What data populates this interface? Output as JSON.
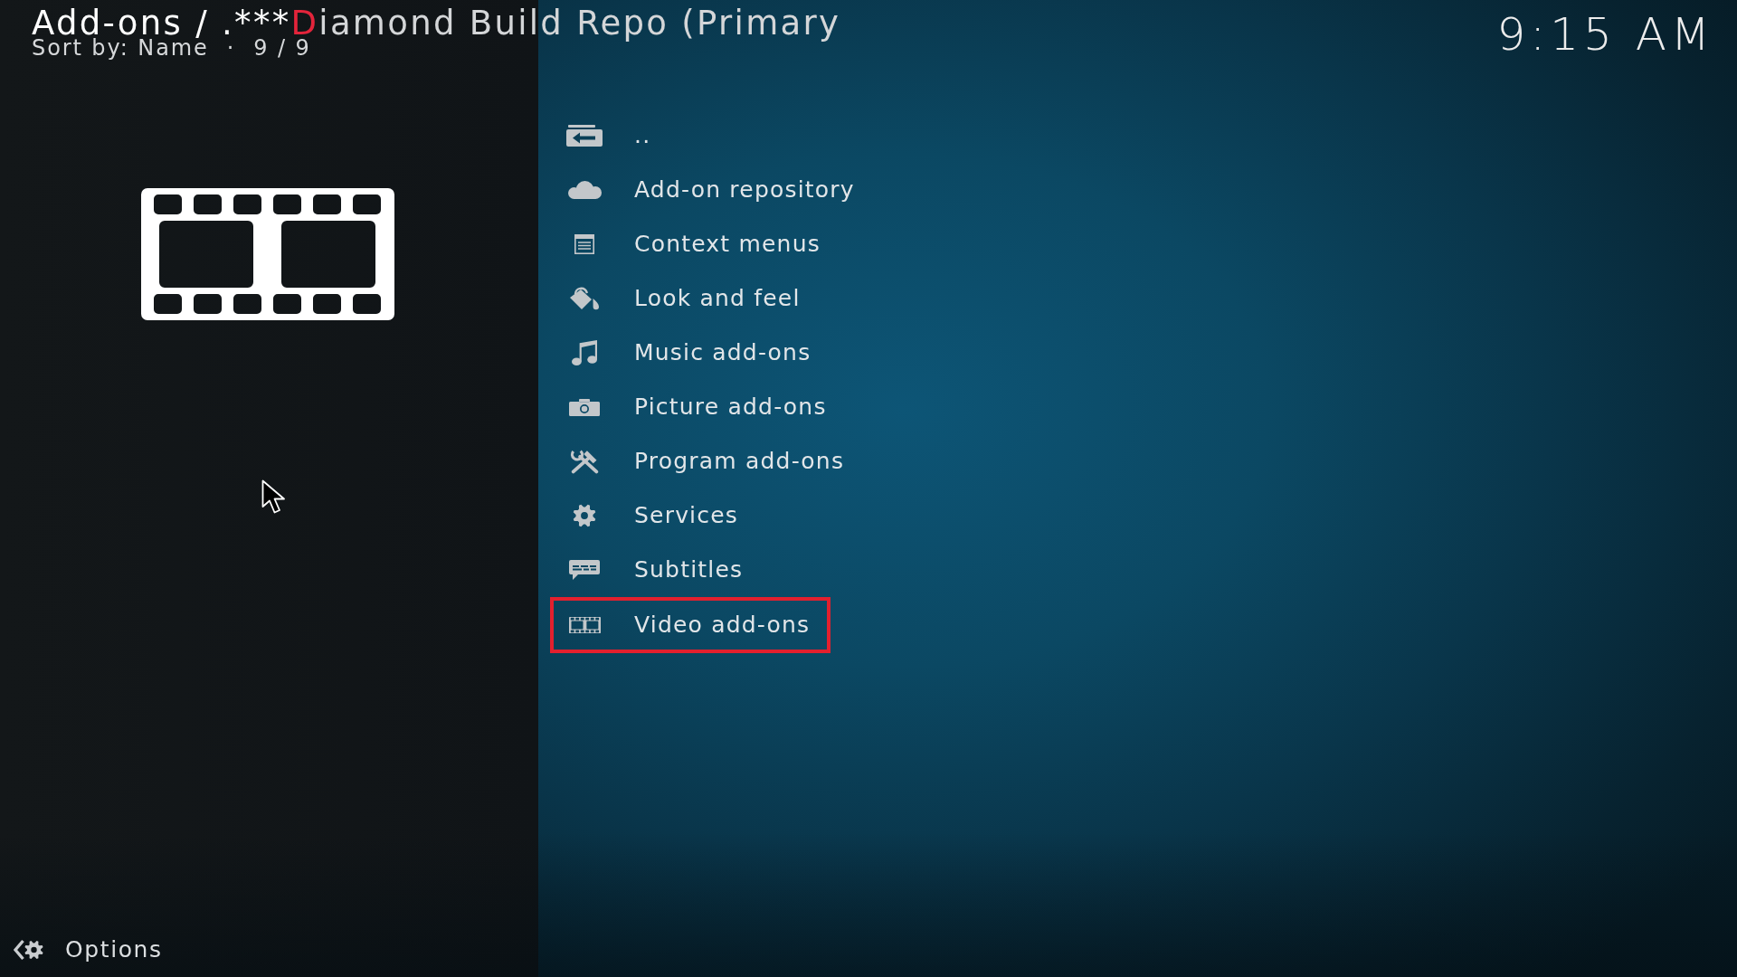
{
  "header": {
    "title": [
      {
        "text": "Add-ons / .***",
        "color": "#ffffff"
      },
      {
        "text": "D",
        "color": "#e3243b"
      },
      {
        "text": "iamond Build Repo (Primary",
        "color": "#d4d6d8"
      }
    ],
    "sort_by": "Sort by: Name",
    "separator": "·",
    "count": "9 / 9",
    "clock": "9:15 AM"
  },
  "items": [
    {
      "kind": "parent",
      "label": "..",
      "selected": false
    },
    {
      "kind": "repository",
      "label": "Add-on repository",
      "selected": false
    },
    {
      "kind": "context",
      "label": "Context menus",
      "selected": false
    },
    {
      "kind": "skin",
      "label": "Look and feel",
      "selected": false
    },
    {
      "kind": "music",
      "label": "Music add-ons",
      "selected": false
    },
    {
      "kind": "picture",
      "label": "Picture add-ons",
      "selected": false
    },
    {
      "kind": "program",
      "label": "Program add-ons",
      "selected": false
    },
    {
      "kind": "service",
      "label": "Services",
      "selected": false
    },
    {
      "kind": "subtitles",
      "label": "Subtitles",
      "selected": false
    },
    {
      "kind": "video",
      "label": "Video add-ons",
      "selected": true
    }
  ],
  "options": {
    "label": "Options"
  }
}
